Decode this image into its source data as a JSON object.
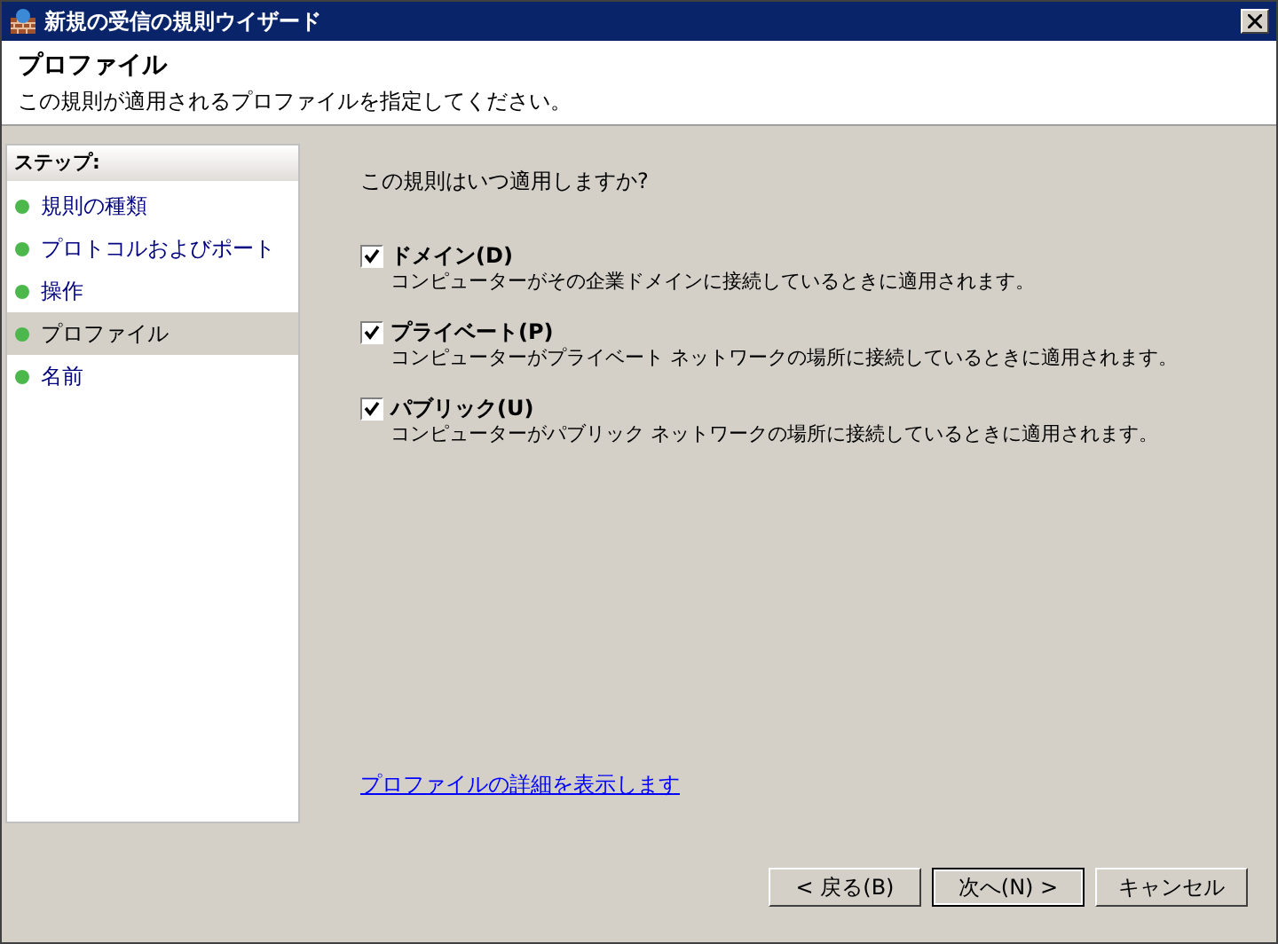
{
  "window": {
    "title": "新規の受信の規則ウイザード"
  },
  "header": {
    "title": "プロファイル",
    "subtitle": "この規則が適用されるプロファイルを指定してください。"
  },
  "steps": {
    "title": "ステップ:",
    "items": [
      {
        "label": "規則の種類",
        "selected": false
      },
      {
        "label": "プロトコルおよびポート",
        "selected": false
      },
      {
        "label": "操作",
        "selected": false
      },
      {
        "label": "プロファイル",
        "selected": true
      },
      {
        "label": "名前",
        "selected": false
      }
    ]
  },
  "question": "この規則はいつ適用しますか?",
  "profiles": [
    {
      "label": "ドメイン(D)",
      "description": "コンピューターがその企業ドメインに接続しているときに適用されます。",
      "checked": true
    },
    {
      "label": "プライベート(P)",
      "description": "コンピューターがプライベート ネットワークの場所に接続しているときに適用されます。",
      "checked": true
    },
    {
      "label": "パブリック(U)",
      "description": "コンピューターがパブリック ネットワークの場所に接続しているときに適用されます。",
      "checked": true
    }
  ],
  "link": "プロファイルの詳細を表示します",
  "buttons": [
    {
      "label": "< 戻る(B)",
      "default": false
    },
    {
      "label": "次へ(N) >",
      "default": true
    },
    {
      "label": "キャンセル",
      "default": false
    }
  ]
}
